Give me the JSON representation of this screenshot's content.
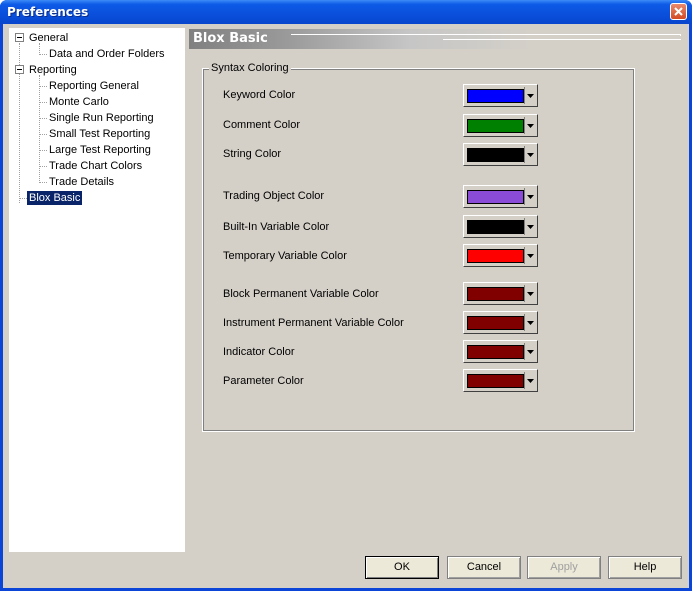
{
  "window": {
    "title": "Preferences"
  },
  "tree": {
    "general": {
      "label": "General",
      "children": [
        "Data and Order Folders"
      ]
    },
    "reporting": {
      "label": "Reporting",
      "children": [
        "Reporting General",
        "Monte Carlo",
        "Single Run Reporting",
        "Small Test Reporting",
        "Large Test Reporting",
        "Trade Chart Colors",
        "Trade Details"
      ]
    },
    "blox_basic": {
      "label": "Blox Basic",
      "selected": true
    }
  },
  "panel": {
    "title": "Blox Basic",
    "group_title": "Syntax Coloring",
    "rows": [
      {
        "label": "Keyword Color",
        "color": "#0000ff"
      },
      {
        "label": "Comment Color",
        "color": "#008000"
      },
      {
        "label": "String Color",
        "color": "#000000"
      },
      {
        "label": "Trading Object Color",
        "color": "#8a4bd6"
      },
      {
        "label": "Built-In Variable Color",
        "color": "#000000"
      },
      {
        "label": "Temporary Variable Color",
        "color": "#ff0000"
      },
      {
        "label": "Block Permanent Variable Color",
        "color": "#800000"
      },
      {
        "label": "Instrument Permanent Variable Color",
        "color": "#800000"
      },
      {
        "label": "Indicator Color",
        "color": "#800000"
      },
      {
        "label": "Parameter Color",
        "color": "#800000"
      }
    ]
  },
  "buttons": {
    "ok": "OK",
    "cancel": "Cancel",
    "apply": "Apply",
    "help": "Help"
  },
  "colors": {
    "titlebar": "#0a4fdc",
    "selection": "#0a246a",
    "dialog_face": "#d4d0c8"
  }
}
